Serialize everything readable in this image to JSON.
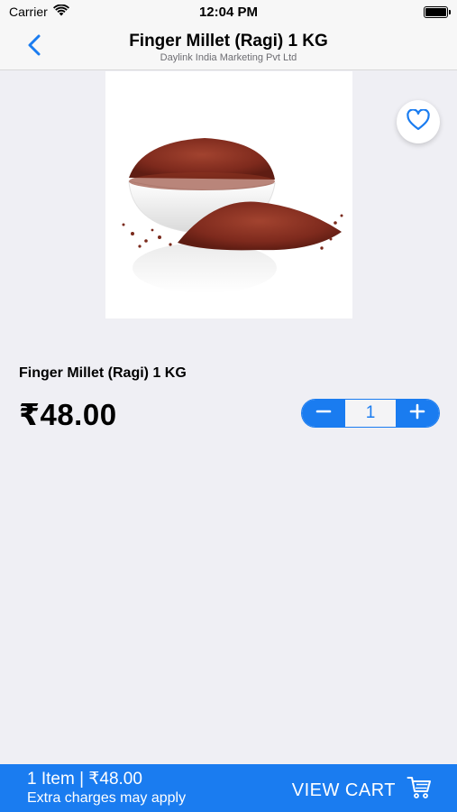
{
  "status_bar": {
    "carrier": "Carrier",
    "time": "12:04 PM"
  },
  "nav": {
    "title": "Finger Millet (Ragi) 1 KG",
    "subtitle": "Daylink India Marketing Pvt Ltd"
  },
  "product": {
    "name": "Finger Millet (Ragi) 1 KG",
    "price": "₹48.00",
    "quantity": "1"
  },
  "cart_bar": {
    "summary": "1 Item | ₹48.00",
    "note": "Extra charges may apply",
    "button_label": "VIEW CART"
  },
  "colors": {
    "accent": "#1a7cf0",
    "background": "#efeff4"
  },
  "icons": {
    "back": "chevron-left-icon",
    "favorite": "heart-outline-icon",
    "decrement": "minus-icon",
    "increment": "plus-icon",
    "cart": "shopping-cart-icon"
  }
}
